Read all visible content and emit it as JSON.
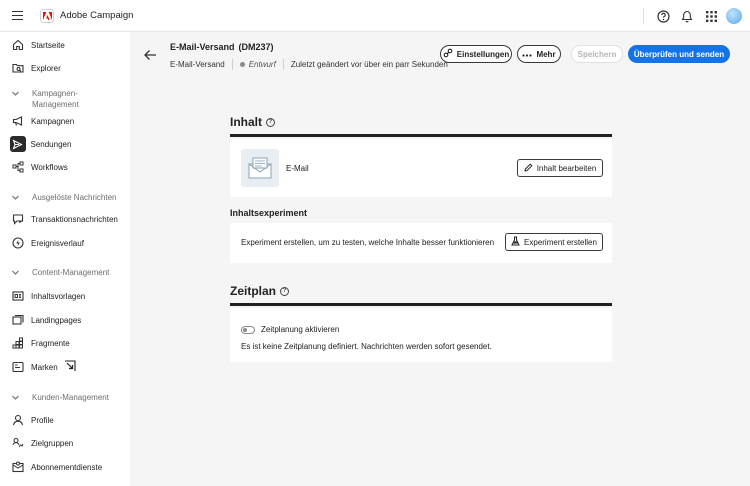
{
  "app": {
    "name": "Adobe Campaign"
  },
  "sidebar": {
    "items": [
      {
        "key": "startseite",
        "label": "Startseite"
      },
      {
        "key": "explorer",
        "label": "Explorer"
      },
      {
        "key": "kampagnen",
        "label": "Kampagnen"
      },
      {
        "key": "sendungen",
        "label": "Sendungen"
      },
      {
        "key": "workflows",
        "label": "Workflows"
      },
      {
        "key": "transaktionsnachrichten",
        "label": "Transaktionsnachrichten"
      },
      {
        "key": "ereignisverlauf",
        "label": "Ereignisverlauf"
      },
      {
        "key": "inhaltsvorlagen",
        "label": "Inhaltsvorlagen"
      },
      {
        "key": "landingpages",
        "label": "Landingpages"
      },
      {
        "key": "fragmente",
        "label": "Fragmente"
      },
      {
        "key": "marken",
        "label": "Marken"
      },
      {
        "key": "profile",
        "label": "Profile"
      },
      {
        "key": "zielgruppen",
        "label": "Zielgruppen"
      },
      {
        "key": "abonnementdienste",
        "label": "Abonnementdienste"
      }
    ],
    "sections": {
      "kampagnen_mgmt_line1": "Kampagnen-",
      "kampagnen_mgmt_line2": "Management",
      "ausgeloeste": "Ausgelöste Nachrichten",
      "content_mgmt": "Content-Management",
      "kunden_mgmt": "Kunden-Management"
    }
  },
  "header": {
    "title": "E-Mail-Versand",
    "id": "(DM237)",
    "channel": "E-Mail-Versand",
    "status": "Entwurf",
    "modified": "Zuletzt geändert vor über ein parr Sekunden",
    "settings_label": "Einstellungen",
    "more_label": "Mehr",
    "save_label": "Speichern",
    "review_label": "Überprüfen und senden"
  },
  "content": {
    "inhalt_title": "Inhalt",
    "email_label": "E-Mail",
    "edit_content_label": "Inhalt bearbeiten",
    "experiment_title": "Inhaltsexperiment",
    "experiment_text": "Experiment erstellen, um zu testen, welche Inhalte besser funktionieren",
    "create_experiment_label": "Experiment erstellen",
    "zeitplan_title": "Zeitplan",
    "schedule_toggle_label": "Zeitplanung aktivieren",
    "schedule_info": "Es ist keine Zeitplanung definiert. Nachrichten werden sofort gesendet."
  },
  "colors": {
    "primary": "#1473e6",
    "brand_red": "#eb1000",
    "active_nav": "#2b2b2b"
  }
}
